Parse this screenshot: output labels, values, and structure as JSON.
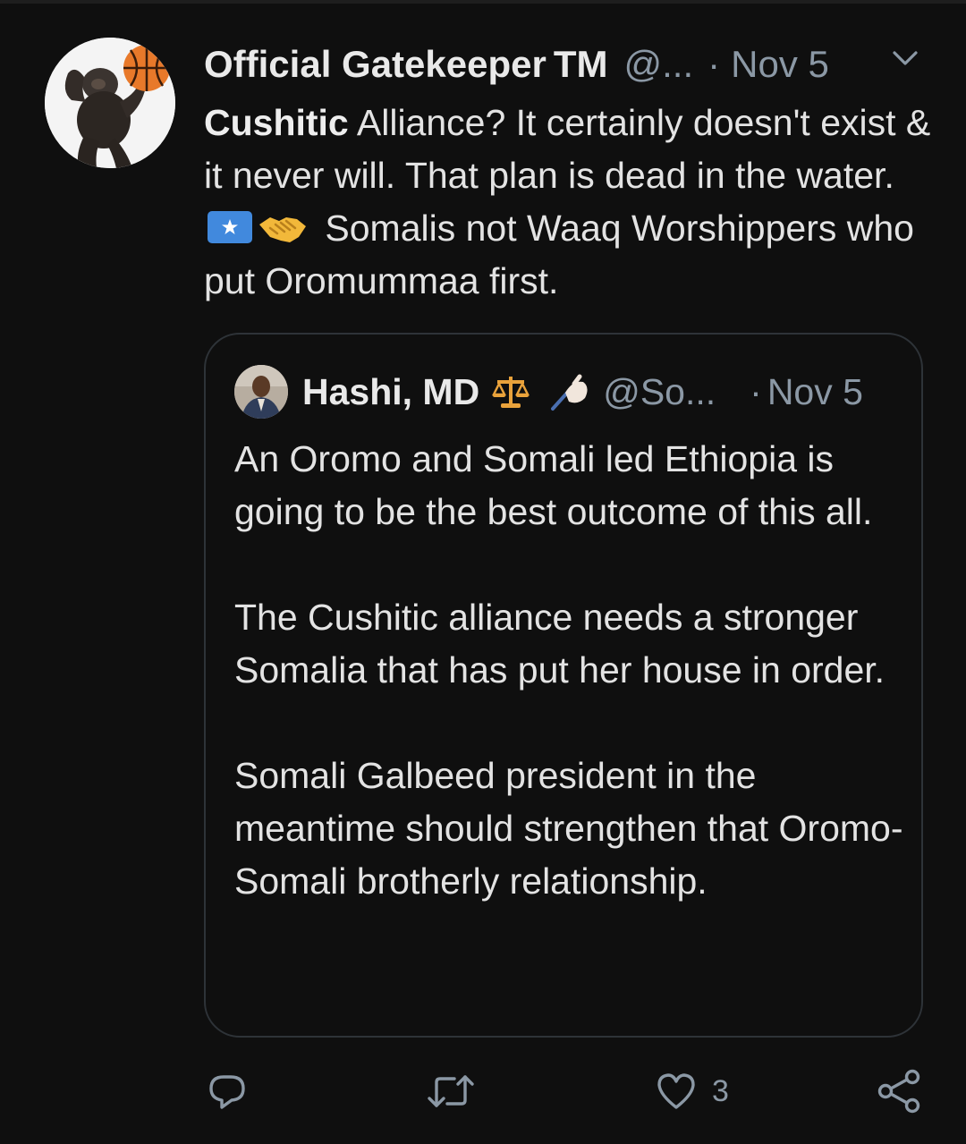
{
  "tweet": {
    "author": {
      "display_name": "Official Gatekeeper",
      "badge": "TM",
      "handle": "@...",
      "separator": "·",
      "date": "Nov 5",
      "avatar_icon": "gorilla-basketball-avatar"
    },
    "menu_icon": "chevron-down-icon",
    "text": {
      "bold_lead": "Cushitic",
      "line_part1": " Alliance? It certainly doesn't exist & it never will. That plan is dead in the water. ",
      "flag_icon": "somalia-flag-icon",
      "handshake_icon": "handshake-icon",
      "line_part2": " Somalis not Waaq Worshippers who put Oromummaa first."
    },
    "quote": {
      "author": {
        "display_name": "Hashi, MD",
        "emoji_1": "balance-scale-icon",
        "emoji_2": "writing-hand-icon",
        "handle": "@So...",
        "separator": "·",
        "date": "Nov 5"
      },
      "paragraphs": [
        "An Oromo and Somali led Ethiopia is going to be the best outcome of this all.",
        "The Cushitic alliance needs a stronger Somalia that has put her house in order.",
        "Somali Galbeed president in the meantime should strengthen that Oromo-Somali brotherly relationship."
      ]
    },
    "actions": {
      "reply_icon": "reply-icon",
      "retweet_icon": "retweet-icon",
      "like_icon": "heart-icon",
      "like_count": "3",
      "share_icon": "share-icon"
    }
  },
  "colors": {
    "background": "#0f0f0f",
    "text": "#e3e3e3",
    "muted": "#8b98a5",
    "quote_border": "#2e3338",
    "flag_blue": "#4189dd",
    "handshake_gold": "#f2b83a",
    "scale_orange": "#e9a23b"
  }
}
